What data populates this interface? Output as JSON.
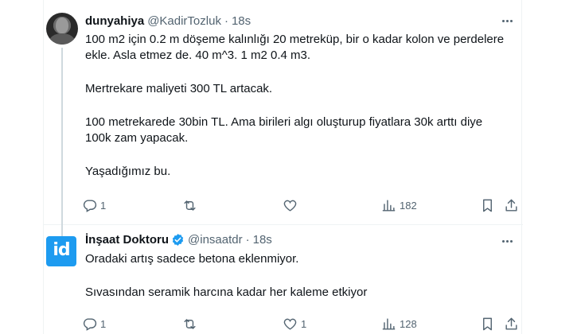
{
  "tweets": [
    {
      "author_name": "dunyahiya",
      "handle": "@KadirTozluk",
      "separator": "·",
      "time": "18s",
      "verified": false,
      "avatar_icon": "user-photo-avatar",
      "paragraphs": [
        "100 m2 için 0.2 m döşeme kalınlığı 20 metreküp, bir o kadar kolon ve perdelere ekle. Asla etmez de. 40 m^3. 1 m2 0.4 m3.",
        "Mertrekare maliyeti 300 TL artacak.",
        "100 metrekarede 30bin TL. Ama birileri algı oluşturup fiyatlara 30k arttı diye 100k zam yapacak.",
        "Yaşadığımız bu."
      ],
      "replies": "1",
      "retweets": "",
      "likes": "",
      "views": "182"
    },
    {
      "author_name": "İnşaat Doktoru",
      "handle": "@insaatdr",
      "separator": "·",
      "time": "18s",
      "verified": true,
      "avatar_text": "id",
      "accent": "#1d9bf0",
      "paragraphs": [
        "Oradaki artış sadece betona eklenmiyor.",
        "Sıvasından seramik harcına kadar her kaleme etkiyor"
      ],
      "replies": "1",
      "retweets": "",
      "likes": "1",
      "views": "128"
    }
  ],
  "colors": {
    "text": "#0f1419",
    "secondary": "#536471",
    "border": "#eff3f4",
    "verified": "#1d9bf0"
  }
}
